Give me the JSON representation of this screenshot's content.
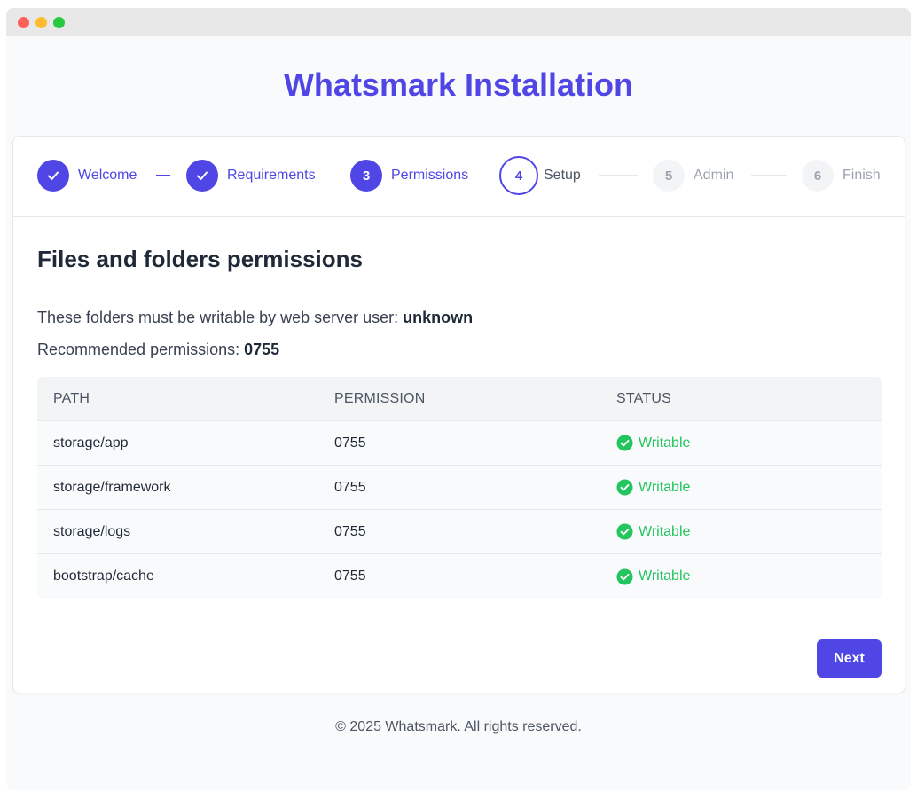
{
  "app": {
    "title": "Whatsmark Installation"
  },
  "steps": [
    {
      "num": "",
      "label": "Welcome",
      "state": "done"
    },
    {
      "num": "",
      "label": "Requirements",
      "state": "done"
    },
    {
      "num": "3",
      "label": "Permissions",
      "state": "active"
    },
    {
      "num": "4",
      "label": "Setup",
      "state": "current"
    },
    {
      "num": "5",
      "label": "Admin",
      "state": "pending"
    },
    {
      "num": "6",
      "label": "Finish",
      "state": "pending"
    }
  ],
  "content": {
    "heading": "Files and folders permissions",
    "writable_prefix": "These folders must be writable by web server user: ",
    "writable_user": "unknown",
    "recommended_prefix": "Recommended permissions: ",
    "recommended_value": "0755"
  },
  "table": {
    "headers": [
      "PATH",
      "PERMISSION",
      "STATUS"
    ],
    "rows": [
      {
        "path": "storage/app",
        "permission": "0755",
        "status": "Writable"
      },
      {
        "path": "storage/framework",
        "permission": "0755",
        "status": "Writable"
      },
      {
        "path": "storage/logs",
        "permission": "0755",
        "status": "Writable"
      },
      {
        "path": "bootstrap/cache",
        "permission": "0755",
        "status": "Writable"
      }
    ]
  },
  "actions": {
    "next_label": "Next"
  },
  "footer": {
    "text": "© 2025 Whatsmark. All rights reserved."
  },
  "colors": {
    "accent": "#4f46e5",
    "success": "#22c55e",
    "muted": "#9ca3af"
  }
}
